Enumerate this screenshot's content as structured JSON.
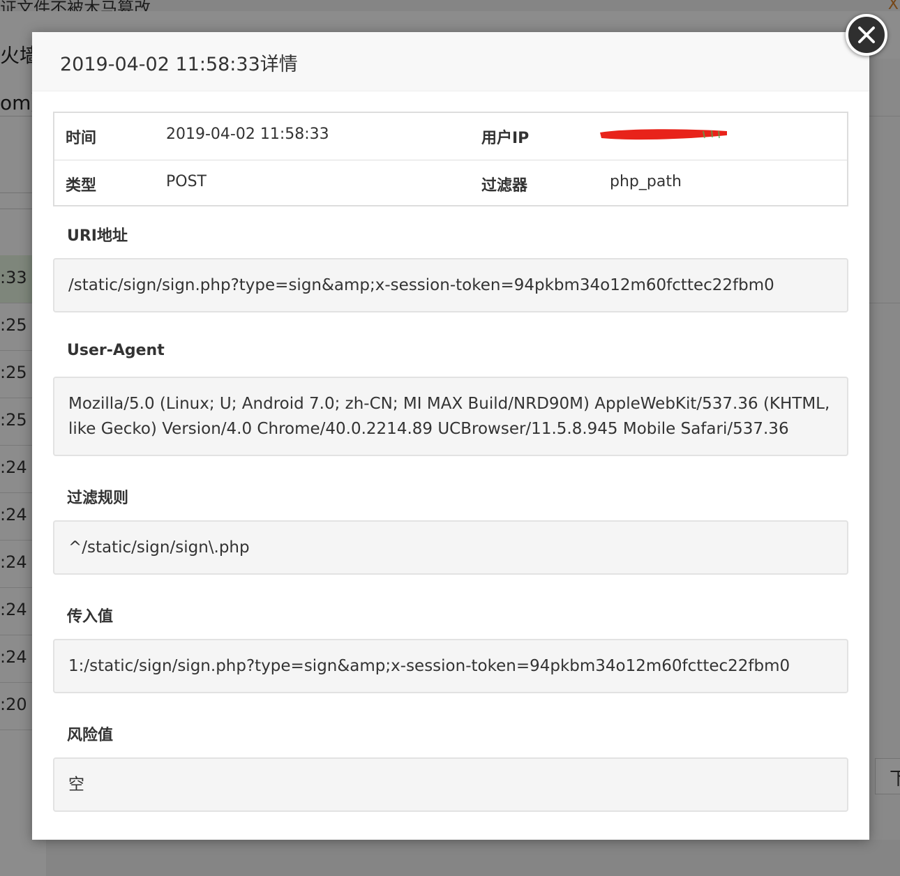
{
  "background": {
    "topbar_text": "证文件不被木马篡改",
    "topbar_close": "X",
    "sidebar_label_1": "火墙",
    "sidebar_label_2": "om】",
    "row_times": [
      ":33",
      ":25",
      ":25",
      ":25",
      ":24",
      ":24",
      ":24",
      ":24",
      ":24",
      ":20"
    ],
    "next_page": "下"
  },
  "modal": {
    "title": "2019-04-02 11:58:33详情",
    "info": {
      "time_label": "时间",
      "time_value": "2019-04-02 11:58:33",
      "ip_label": "用户IP",
      "type_label": "类型",
      "type_value": "POST",
      "filter_label": "过滤器",
      "filter_value": "php_path"
    },
    "sections": {
      "uri_label": "URI地址",
      "uri_value": "/static/sign/sign.php?type=sign&amp;x-session-token=94pkbm34o12m60fcttec22fbm0",
      "ua_label": "User-Agent",
      "ua_value": "Mozilla/5.0 (Linux; U; Android 7.0; zh-CN; MI MAX Build/NRD90M) AppleWebKit/537.36 (KHTML, like Gecko) Version/4.0 Chrome/40.0.2214.89 UCBrowser/11.5.8.945 Mobile Safari/537.36",
      "rule_label": "过滤规则",
      "rule_value": "^/static/sign/sign\\.php",
      "input_label": "传入值",
      "input_value": "1:/static/sign/sign.php?type=sign&amp;x-session-token=94pkbm34o12m60fcttec22fbm0",
      "risk_label": "风险值",
      "risk_value": "空"
    }
  },
  "colors": {
    "redaction": "#e8231a",
    "highlight_row": "#e6f4e1"
  }
}
